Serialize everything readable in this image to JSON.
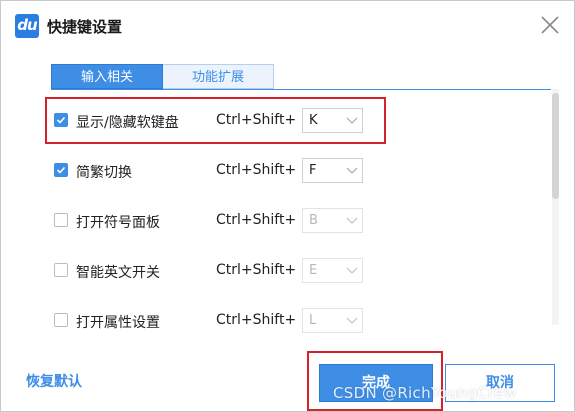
{
  "window": {
    "logo_text": "du",
    "title": "快捷键设置",
    "close_icon": "close-icon"
  },
  "tabs": [
    {
      "label": "输入相关",
      "active": true
    },
    {
      "label": "功能扩展",
      "active": false
    }
  ],
  "shortcuts": [
    {
      "label": "显示/隐藏软键盘",
      "checked": true,
      "combo": "Ctrl+Shift+",
      "key": "K",
      "enabled": true,
      "highlighted": true
    },
    {
      "label": "简繁切换",
      "checked": true,
      "combo": "Ctrl+Shift+",
      "key": "F",
      "enabled": true,
      "highlighted": false
    },
    {
      "label": "打开符号面板",
      "checked": false,
      "combo": "Ctrl+Shift+",
      "key": "B",
      "enabled": false,
      "highlighted": false
    },
    {
      "label": "智能英文开关",
      "checked": false,
      "combo": "Ctrl+Shift+",
      "key": "E",
      "enabled": false,
      "highlighted": false
    },
    {
      "label": "打开属性设置",
      "checked": false,
      "combo": "Ctrl+Shift+",
      "key": "L",
      "enabled": false,
      "highlighted": false
    }
  ],
  "footer": {
    "restore_label": "恢复默认",
    "ok_label": "完成",
    "cancel_label": "取消"
  },
  "watermark": "CSDN @RichYoungCrew",
  "colors": {
    "accent": "#3e8ee6",
    "highlight": "#d6222b"
  }
}
